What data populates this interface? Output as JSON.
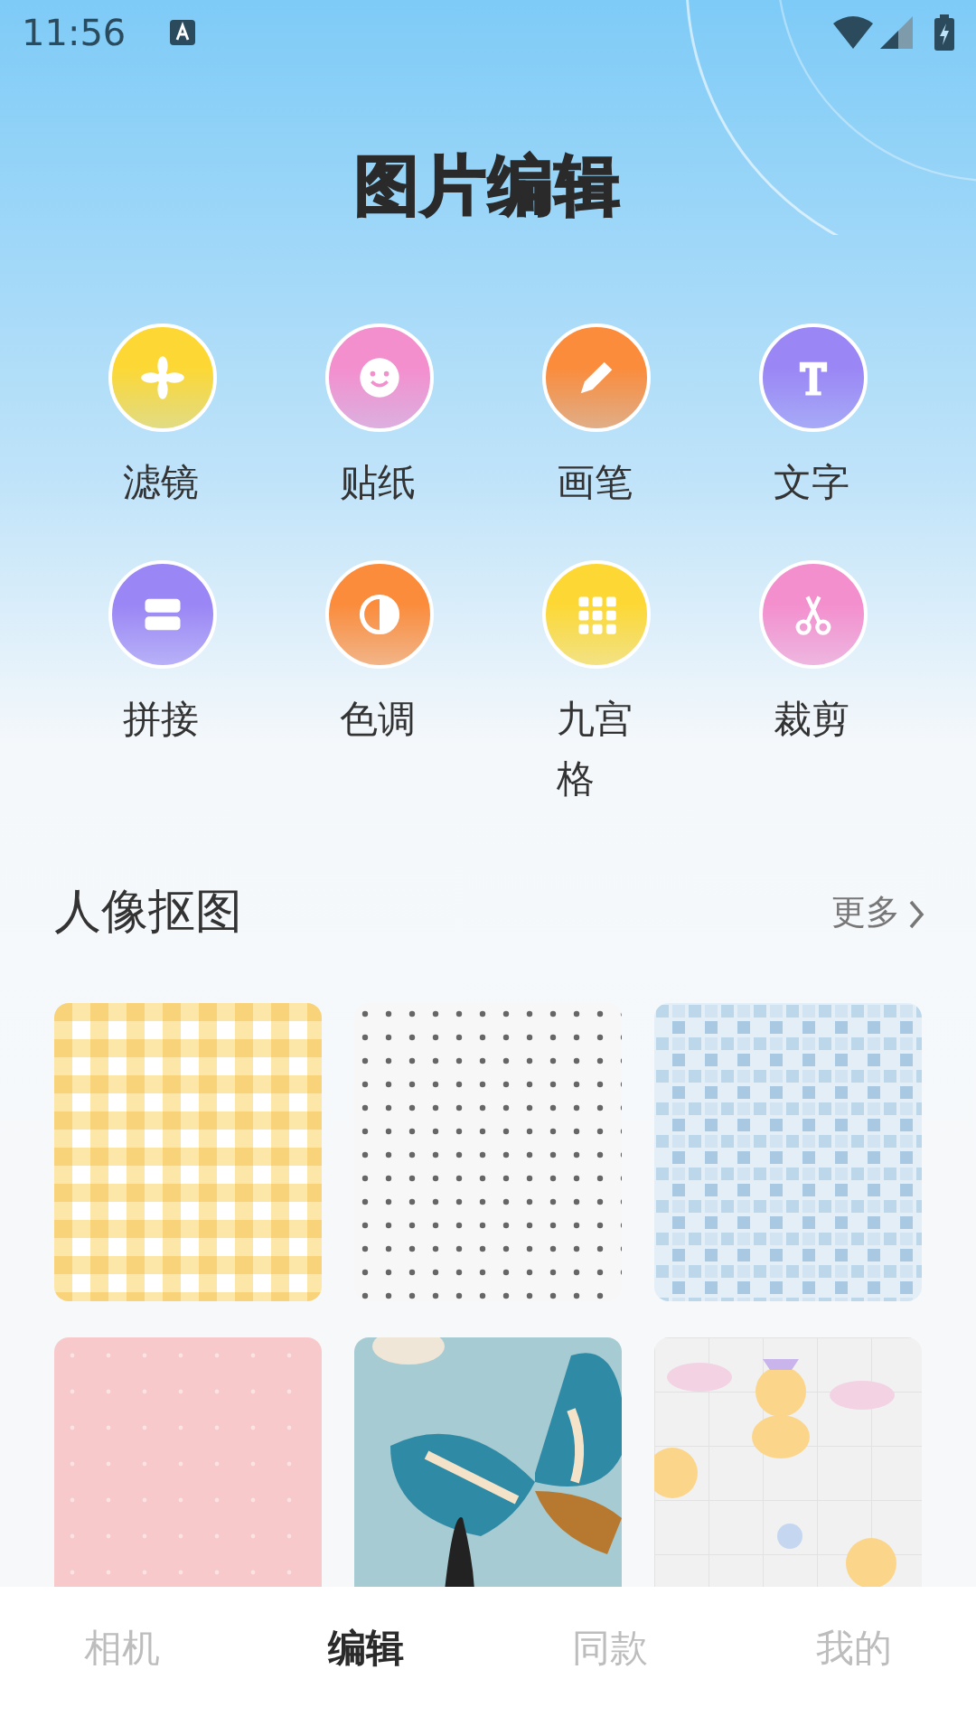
{
  "status_bar": {
    "time": "11:56"
  },
  "title": "图片编辑",
  "tools": [
    {
      "label": "滤镜",
      "kind": "flower",
      "color": "#fdd835"
    },
    {
      "label": "贴纸",
      "kind": "smile",
      "color": "#f48fce"
    },
    {
      "label": "画笔",
      "kind": "pen",
      "color": "#fb8c3c"
    },
    {
      "label": "文字",
      "kind": "text",
      "color": "#9b86f5"
    },
    {
      "label": "拼接",
      "kind": "split",
      "color": "#9b86f5"
    },
    {
      "label": "色调",
      "kind": "tone",
      "color": "#fb8c3c"
    },
    {
      "label": "九宫格",
      "kind": "grid",
      "color": "#fdd835"
    },
    {
      "label": "裁剪",
      "kind": "scissors",
      "color": "#f48fce"
    }
  ],
  "section": {
    "title": "人像抠图",
    "more": "更多"
  },
  "nav": [
    {
      "label": "相机",
      "selected": false
    },
    {
      "label": "编辑",
      "selected": true
    },
    {
      "label": "同款",
      "selected": false
    },
    {
      "label": "我的",
      "selected": false
    }
  ]
}
